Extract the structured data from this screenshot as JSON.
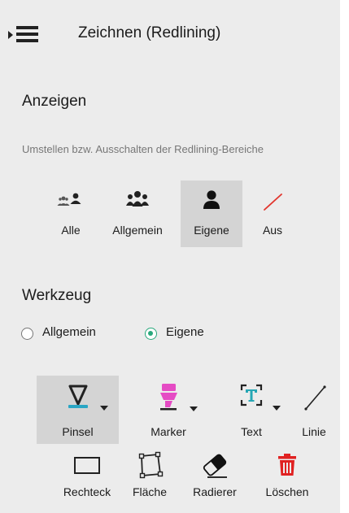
{
  "header": {
    "title": "Zeichnen (Redlining)"
  },
  "display": {
    "title": "Anzeigen",
    "description": "Umstellen bzw. Ausschalten der Redlining-Bereiche",
    "buttons": [
      {
        "label": "Alle",
        "icon": "users-mixed-icon",
        "selected": false
      },
      {
        "label": "Allgemein",
        "icon": "users-group-icon",
        "selected": false
      },
      {
        "label": "Eigene",
        "icon": "user-icon",
        "selected": true
      },
      {
        "label": "Aus",
        "icon": "off-slash-icon",
        "selected": false
      }
    ]
  },
  "tools": {
    "title": "Werkzeug",
    "radios": [
      {
        "label": "Allgemein",
        "checked": false
      },
      {
        "label": "Eigene",
        "checked": true
      }
    ],
    "row1": [
      {
        "label": "Pinsel",
        "icon": "brush-icon",
        "selected": true,
        "has_dropdown": true
      },
      {
        "label": "Marker",
        "icon": "marker-icon",
        "selected": false,
        "has_dropdown": true
      },
      {
        "label": "Text",
        "icon": "text-icon",
        "selected": false,
        "has_dropdown": true
      },
      {
        "label": "Linie",
        "icon": "line-icon",
        "selected": false,
        "has_dropdown": false
      }
    ],
    "row2": [
      {
        "label": "Rechteck",
        "icon": "rectangle-icon"
      },
      {
        "label": "Fläche",
        "icon": "polygon-icon"
      },
      {
        "label": "Radierer",
        "icon": "eraser-icon"
      },
      {
        "label": "Löschen",
        "icon": "trash-icon"
      }
    ]
  },
  "colors": {
    "panel_bg": "#ececec",
    "selected_bg": "#d4d4d4",
    "radio_accent": "#29a87c",
    "brush_blue": "#2aa6c4",
    "marker_pink": "#e54bc4",
    "text_teal": "#27a7b5",
    "off_red": "#e2352d",
    "trash_red": "#e02222"
  }
}
